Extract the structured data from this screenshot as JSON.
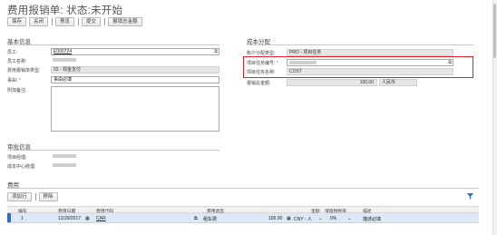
{
  "header": {
    "title": "费用报销单: 状态:未开始"
  },
  "toolbar": {
    "save": "保存",
    "close": "关闭",
    "preview": "预览",
    "submit": "提交",
    "reimburse_amount": "报销总金额"
  },
  "basic_info": {
    "section_title": "基本信息",
    "employee_label": "员工:",
    "employee_value": "E000724",
    "employee_name_label": "员工名称:",
    "reimb_type_label": "费用报销单类型:",
    "reimb_type_value": "02 - 现金支付",
    "reason_label": "事由:",
    "reason_value": "事由必填",
    "remark_label": "附加备注:"
  },
  "cost_assignment": {
    "section_title": "成本分配",
    "account_type_label": "账户分配类型:",
    "account_type_value": "PRO - 项目任务",
    "project_task_id_label": "项目任务编号:",
    "project_task_name_label": "项目任务名称:",
    "project_task_name_value": "COST",
    "total_amount_label": "报销总金额:",
    "total_amount_value": "100.00",
    "currency": "人民币"
  },
  "approval_info": {
    "section_title": "审批信息",
    "project_manager_label": "项目经理:",
    "cost_center_manager_label": "成本中心经理:"
  },
  "expenses": {
    "section_title": "费用",
    "add_row": "添加行",
    "delete": "移除",
    "columns": [
      "编号",
      "费用日期",
      "费用代码",
      "费用类型",
      "金额",
      "增值税税率",
      "描述"
    ],
    "rows": [
      {
        "no": "1",
        "date": "12/29/2017",
        "code": "CAR",
        "type": "租车费",
        "amount": "100.00",
        "currency": "CNY - 人",
        "tax_rate": "0%",
        "desc": "描述必填"
      }
    ]
  }
}
